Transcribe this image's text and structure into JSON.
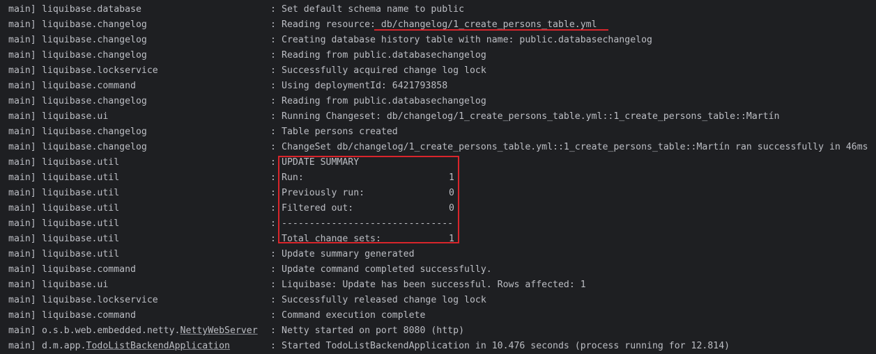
{
  "colors": {
    "background": "#1e1f22",
    "text": "#bcbec4",
    "annotation": "#d9252b"
  },
  "lines": [
    {
      "thread": "main]",
      "logger": "liquibase.database",
      "sep": ":",
      "message": "Set default schema name to public"
    },
    {
      "thread": "main]",
      "logger": "liquibase.changelog",
      "sep": ":",
      "message": "Reading resource: db/changelog/1_create_persons_table.yml"
    },
    {
      "thread": "main]",
      "logger": "liquibase.changelog",
      "sep": ":",
      "message": "Creating database history table with name: public.databasechangelog"
    },
    {
      "thread": "main]",
      "logger": "liquibase.changelog",
      "sep": ":",
      "message": "Reading from public.databasechangelog"
    },
    {
      "thread": "main]",
      "logger": "liquibase.lockservice",
      "sep": ":",
      "message": "Successfully acquired change log lock"
    },
    {
      "thread": "main]",
      "logger": "liquibase.command",
      "sep": ":",
      "message": "Using deploymentId: 6421793858"
    },
    {
      "thread": "main]",
      "logger": "liquibase.changelog",
      "sep": ":",
      "message": "Reading from public.databasechangelog"
    },
    {
      "thread": "main]",
      "logger": "liquibase.ui",
      "sep": ":",
      "message": "Running Changeset: db/changelog/1_create_persons_table.yml::1_create_persons_table::Martín"
    },
    {
      "thread": "main]",
      "logger": "liquibase.changelog",
      "sep": ":",
      "message": "Table persons created"
    },
    {
      "thread": "main]",
      "logger": "liquibase.changelog",
      "sep": ":",
      "message": "ChangeSet db/changelog/1_create_persons_table.yml::1_create_persons_table::Martín ran successfully in 46ms"
    },
    {
      "thread": "main]",
      "logger": "liquibase.util",
      "sep": ":",
      "message": "UPDATE SUMMARY"
    },
    {
      "thread": "main]",
      "logger": "liquibase.util",
      "sep": ":",
      "label": "Run:",
      "value": "1"
    },
    {
      "thread": "main]",
      "logger": "liquibase.util",
      "sep": ":",
      "label": "Previously run:",
      "value": "0"
    },
    {
      "thread": "main]",
      "logger": "liquibase.util",
      "sep": ":",
      "label": "Filtered out:",
      "value": "0"
    },
    {
      "thread": "main]",
      "logger": "liquibase.util",
      "sep": ":",
      "message": "-------------------------------"
    },
    {
      "thread": "main]",
      "logger": "liquibase.util",
      "sep": ":",
      "label": "Total change sets:",
      "value": "1"
    },
    {
      "thread": "main]",
      "logger": "liquibase.util",
      "sep": ":",
      "message": "Update summary generated"
    },
    {
      "thread": "main]",
      "logger": "liquibase.command",
      "sep": ":",
      "message": "Update command completed successfully."
    },
    {
      "thread": "main]",
      "logger": "liquibase.ui",
      "sep": ":",
      "message": "Liquibase: Update has been successful. Rows affected: 1"
    },
    {
      "thread": "main]",
      "logger": "liquibase.lockservice",
      "sep": ":",
      "message": "Successfully released change log lock"
    },
    {
      "thread": "main]",
      "logger": "liquibase.command",
      "sep": ":",
      "message": "Command execution complete"
    },
    {
      "thread": "main]",
      "logger_prefix": "o.s.b.web.embedded.netty.",
      "logger_link": "NettyWebServer",
      "sep": ":",
      "message": "Netty started on port 8080 (http)"
    },
    {
      "thread": "main]",
      "logger_prefix": "d.m.app.",
      "logger_link": "TodoListBackendApplication",
      "sep": ":",
      "message": "Started TodoListBackendApplication in 10.476 seconds (process running for 12.814)"
    }
  ]
}
